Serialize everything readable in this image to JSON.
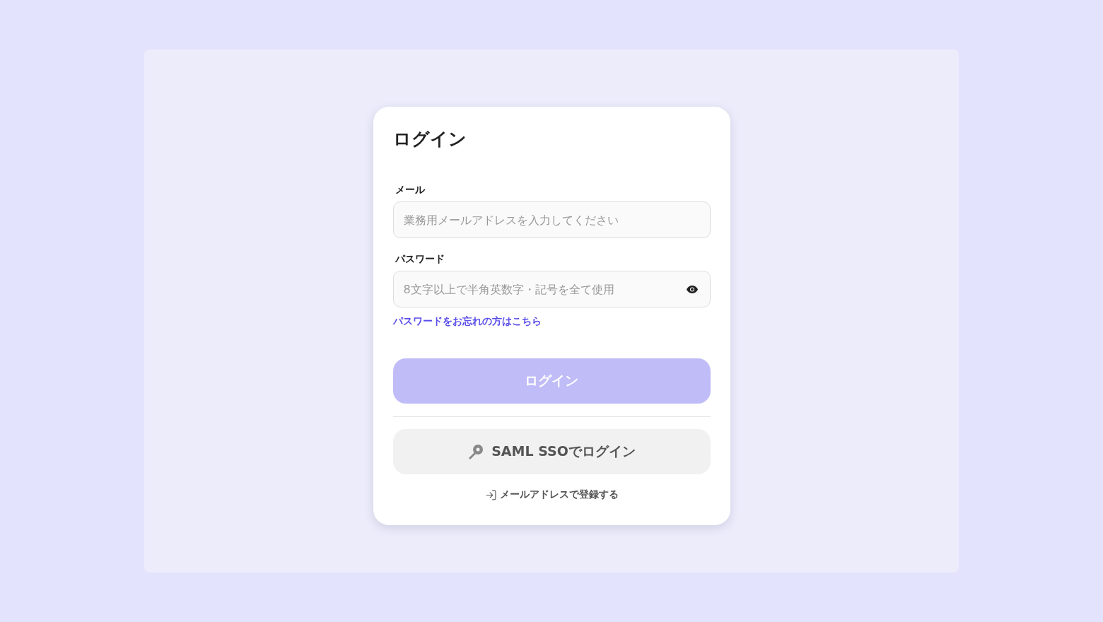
{
  "title": "ログイン",
  "fields": [
    {
      "label": "メール",
      "placeholder": "業務用メールアドレスを入力してください",
      "kind": "email"
    },
    {
      "label": "パスワード",
      "placeholder": "8文字以上で半角英数字・記号を全て使用",
      "kind": "password"
    }
  ],
  "forgot_link": "パスワードをお忘れの方はこちら",
  "login_button": {
    "label": "ログイン",
    "disabled": true
  },
  "sso_button": {
    "label": "SAML SSOでログイン"
  },
  "register_link": "メールアドレスで登録する"
}
